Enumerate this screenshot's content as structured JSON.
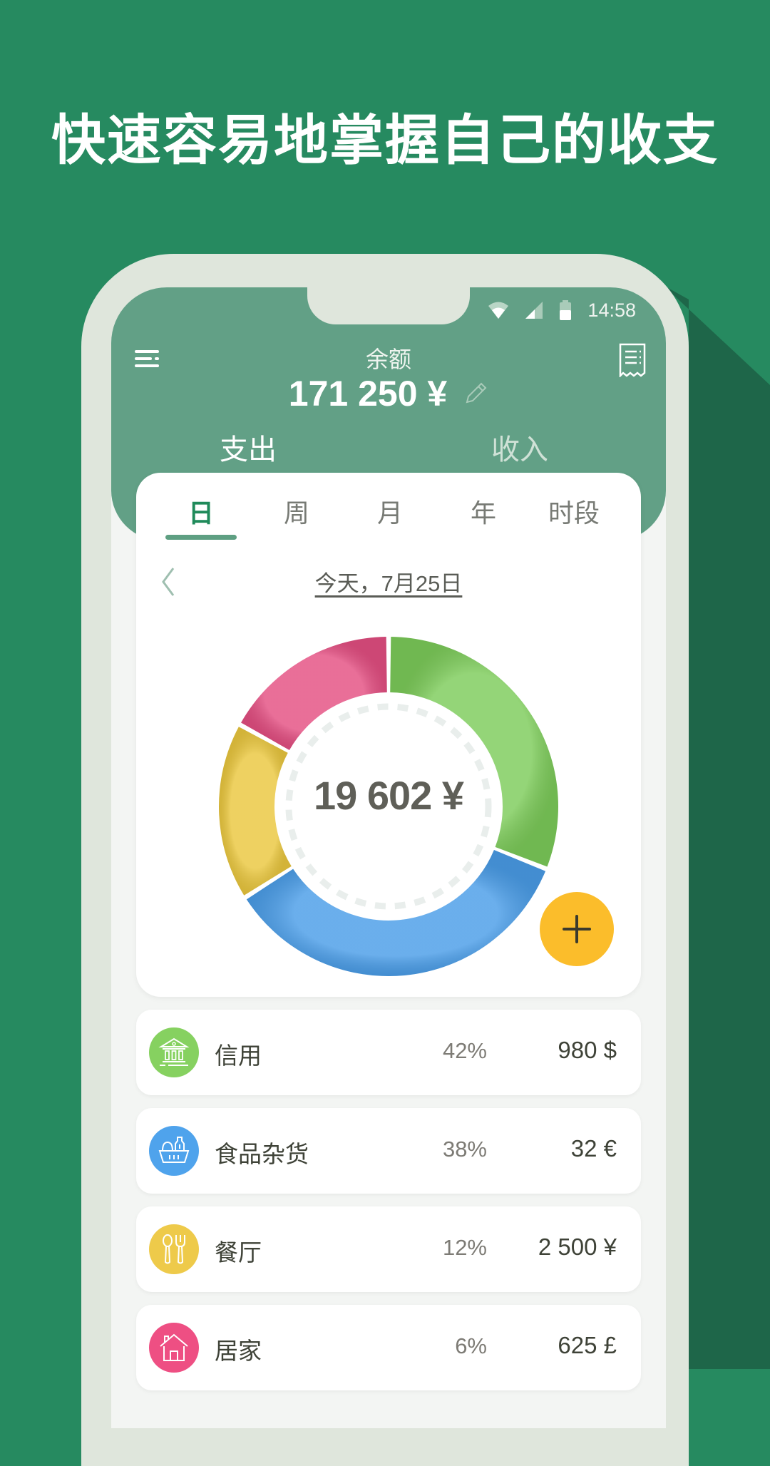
{
  "headline": "快速容易地掌握自己的收支",
  "colors": {
    "background": "#268a60",
    "background_shadow": "#1e6649",
    "phone_frame": "#dfe6dc",
    "app_header": "#62a086",
    "accent": "#1f8a5a",
    "fab": "#fbbd2b"
  },
  "status_bar": {
    "wifi_icon": "wifi-icon",
    "signal_icon": "cell-signal-icon",
    "battery_icon": "battery-icon",
    "time": "14:58"
  },
  "header": {
    "menu_icon": "menu-icon",
    "receipt_icon": "receipt-icon",
    "balance_label": "余额",
    "balance_value": "171 250 ¥",
    "edit_icon": "pencil-icon",
    "type_tabs": [
      {
        "label": "支出",
        "active": true
      },
      {
        "label": "收入",
        "active": false
      }
    ]
  },
  "period_tabs": [
    {
      "label": "日",
      "active": true
    },
    {
      "label": "周",
      "active": false
    },
    {
      "label": "月",
      "active": false
    },
    {
      "label": "年",
      "active": false
    },
    {
      "label": "时段",
      "active": false
    }
  ],
  "date_nav": {
    "back_icon": "chevron-left-icon",
    "label": "今天，7月25日"
  },
  "chart_data": {
    "type": "pie",
    "subtype": "donut",
    "center_label": "19 602 ¥",
    "categories": [
      "信用",
      "食品杂货",
      "餐厅",
      "居家"
    ],
    "values": [
      31,
      35,
      17,
      17
    ],
    "colors": [
      "#7dcc5a",
      "#4a9de8",
      "#eac73e",
      "#e44f82"
    ],
    "start_angle_deg": 0,
    "direction": "clockwise",
    "legend": "none"
  },
  "fab": {
    "icon": "plus-icon"
  },
  "categories": [
    {
      "name": "信用",
      "percent": "42%",
      "amount": "980 $",
      "icon": "bank-icon",
      "color": "#86d160"
    },
    {
      "name": "食品杂货",
      "percent": "38%",
      "amount": "32 €",
      "icon": "grocery-basket-icon",
      "color": "#4fa3ec"
    },
    {
      "name": "餐厅",
      "percent": "12%",
      "amount": "2 500 ¥",
      "icon": "cutlery-icon",
      "color": "#eeca4a"
    },
    {
      "name": "居家",
      "percent": "6%",
      "amount": "625 £",
      "icon": "house-icon",
      "color": "#ee4f83"
    }
  ]
}
